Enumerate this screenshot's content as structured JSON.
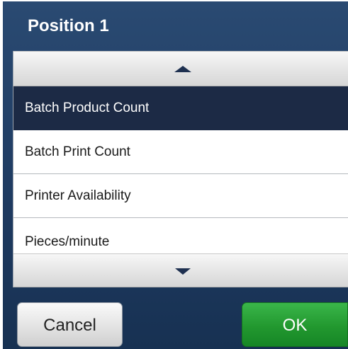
{
  "dialog": {
    "title": "Position 1"
  },
  "list": {
    "items": [
      {
        "label": "Batch Product Count",
        "selected": true
      },
      {
        "label": "Batch Print Count",
        "selected": false
      },
      {
        "label": "Printer Availability",
        "selected": false
      },
      {
        "label": "Pieces/minute",
        "selected": false
      }
    ]
  },
  "buttons": {
    "cancel_label": "Cancel",
    "ok_label": "OK"
  },
  "icons": {
    "scroll_up": "triangle-up",
    "scroll_down": "triangle-down"
  },
  "colors": {
    "header_bg": "#1e3a60",
    "selected_bg": "#1c2a45",
    "ok_green": "#22982f"
  }
}
